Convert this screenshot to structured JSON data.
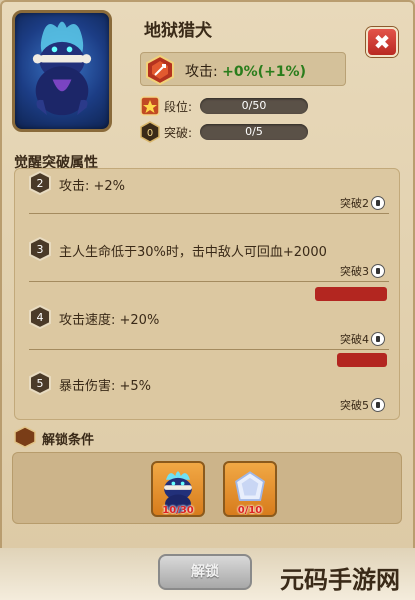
{
  "hero": {
    "name": "地狱猎犬"
  },
  "close": {
    "label": "✖"
  },
  "attack": {
    "label": "攻击:",
    "value": "+0%(+1%)"
  },
  "rank": {
    "label": "段位:",
    "progress": "0/50",
    "fraction": 0
  },
  "breakthrough": {
    "label": "突破:",
    "progress": "0/5",
    "fraction": 0,
    "icon_digit": "0"
  },
  "section_title": "觉醒突破属性",
  "items": [
    {
      "badge": "2",
      "text": "攻击: +2%",
      "tag": "突破2"
    },
    {
      "badge": "3",
      "text": "主人生命低于30%时，击中敌人可回血+2000",
      "tag": "突破3"
    },
    {
      "badge": "4",
      "text": "攻击速度: +20%",
      "tag": "突破4"
    },
    {
      "badge": "5",
      "text": "暴击伤害: +5%",
      "tag": "突破5"
    }
  ],
  "unlock_title": "解锁条件",
  "requirements": [
    {
      "icon": "hellhound-shard-icon",
      "count": "10/30"
    },
    {
      "icon": "crystal-icon",
      "count": "0/10"
    }
  ],
  "unlock_button": "解锁",
  "watermark": "元码手游网",
  "colors": {
    "accent_green": "#2a7d1c",
    "close_red": "#d63b31",
    "count_red": "#dd2222"
  }
}
